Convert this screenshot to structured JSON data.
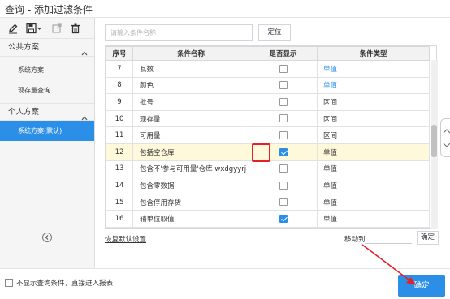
{
  "window": {
    "title": "查询 - 添加过滤条件"
  },
  "toolbar": {
    "icons": [
      "edit-icon",
      "save-icon",
      "export-icon",
      "delete-icon"
    ]
  },
  "sidebar": {
    "public_header": "公共方案",
    "public_items": [
      "系统方案",
      "现存量查询"
    ],
    "personal_header": "个人方案",
    "personal_items": [
      "系统方案(默认)"
    ]
  },
  "search": {
    "placeholder": "请输入条件名称",
    "locate_label": "定位"
  },
  "grid": {
    "headers": [
      "序号",
      "条件名称",
      "是否显示",
      "条件类型"
    ],
    "rows": [
      {
        "no": "7",
        "name": "瓦数",
        "show": false,
        "type": "单值"
      },
      {
        "no": "8",
        "name": "颜色",
        "show": false,
        "type": "单值"
      },
      {
        "no": "9",
        "name": "批号",
        "show": false,
        "type": "区间"
      },
      {
        "no": "10",
        "name": "现存量",
        "show": false,
        "type": "区间"
      },
      {
        "no": "11",
        "name": "可用量",
        "show": false,
        "type": "区间"
      },
      {
        "no": "12",
        "name": "包括空仓库",
        "show": true,
        "type": "单值"
      },
      {
        "no": "13",
        "name": "包含不'参与可用量'仓库 wxdgyyrj",
        "show": false,
        "type": "单值"
      },
      {
        "no": "14",
        "name": "包含零数据",
        "show": false,
        "type": "单值"
      },
      {
        "no": "15",
        "name": "包含停用存货",
        "show": false,
        "type": "单值"
      },
      {
        "no": "16",
        "name": "辅单位取值",
        "show": true,
        "type": "单值"
      }
    ]
  },
  "bottom": {
    "restore_label": "恢复默认设置",
    "move_label": "移动到",
    "move_button": "确定",
    "skip_label": "不显示查询条件，直接进入报表",
    "confirm_label": "确定"
  },
  "colors": {
    "accent": "#2b8fe8",
    "annotation": "#e6202a",
    "highlight_row": "#fff9dc"
  }
}
